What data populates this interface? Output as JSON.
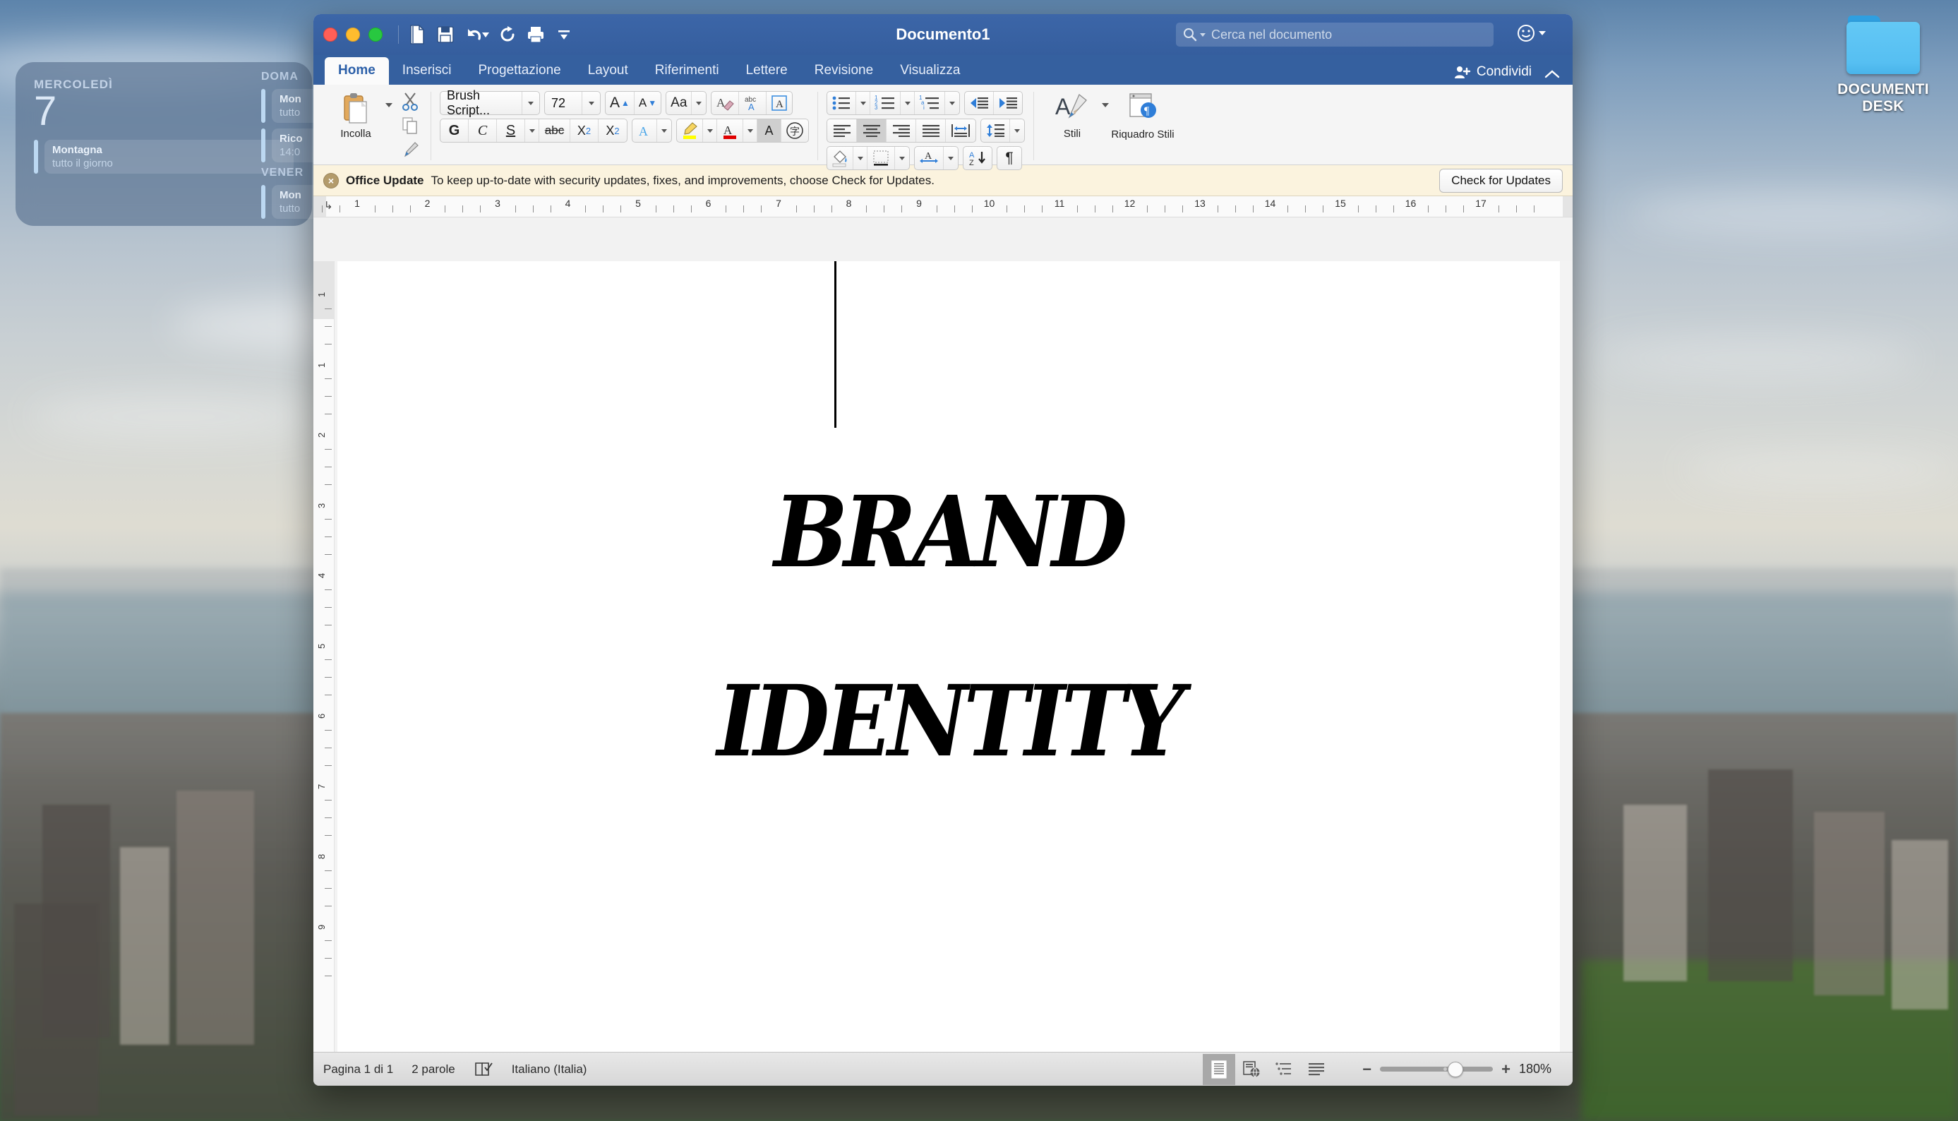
{
  "desktop": {
    "icon": {
      "name": "DOCUMENTI DESK",
      "kind": "folder"
    },
    "wallpaper_description": "Aerial view of New York City skyline at dusk"
  },
  "calendar_widget": {
    "days": [
      {
        "label": "MERCOLEDÌ",
        "number": "7",
        "events": [
          {
            "title": "Montagna",
            "time": "tutto il giorno"
          }
        ]
      },
      {
        "label": "DOMA",
        "events": [
          {
            "title": "Mon",
            "time": "tutto"
          },
          {
            "title": "Rico",
            "time": "14:0"
          }
        ]
      },
      {
        "label": "VENER",
        "events": [
          {
            "title": "Mon",
            "time": "tutto"
          }
        ]
      }
    ]
  },
  "window": {
    "title": "Documento1",
    "traffic_lights": [
      "close-red",
      "minimize-yellow",
      "maximize-green"
    ],
    "quick_access": [
      {
        "name": "new-document-icon",
        "label": "Nuovo"
      },
      {
        "name": "save-icon",
        "label": "Salva"
      },
      {
        "name": "undo-icon",
        "label": "Annulla"
      },
      {
        "name": "redo-icon",
        "label": "Ripeti"
      },
      {
        "name": "print-icon",
        "label": "Stampa"
      },
      {
        "name": "customize-toolbar-icon",
        "label": "Personalizza"
      }
    ],
    "search": {
      "placeholder": "Cerca nel documento",
      "value": ""
    },
    "smiley_label": "Feedback"
  },
  "ribbon": {
    "tabs": [
      {
        "label": "Home",
        "active": true
      },
      {
        "label": "Inserisci",
        "active": false
      },
      {
        "label": "Progettazione",
        "active": false
      },
      {
        "label": "Layout",
        "active": false
      },
      {
        "label": "Riferimenti",
        "active": false
      },
      {
        "label": "Lettere",
        "active": false
      },
      {
        "label": "Revisione",
        "active": false
      },
      {
        "label": "Visualizza",
        "active": false
      }
    ],
    "share_label": "Condividi",
    "collapse_label": "^",
    "clipboard": {
      "paste_label": "Incolla",
      "cut_label": "Taglia",
      "copy_label": "Copia",
      "format_painter_label": "Copia formato"
    },
    "font": {
      "family_value": "Brush Script...",
      "size_value": "72",
      "grow_label": "A",
      "shrink_label": "A",
      "change_case_label": "Aa",
      "clear_formatting_label": "A",
      "spelling_label": "abc",
      "text_effects_label": "A",
      "bold_label": "G",
      "italic_label": "C",
      "underline_label": "S",
      "strikethrough_label": "abc",
      "subscript_label": "X₂",
      "superscript_label": "X²",
      "text_highlight_label": "A",
      "font_color_label": "A",
      "shading_label": "A",
      "phonetic_label": "字"
    },
    "paragraph": {
      "bullets_label": "Elenco puntato",
      "numbering_label": "Elenco numerato",
      "multilevel_label": "Elenco multilivello",
      "decrease_indent_label": "Riduci rientro",
      "increase_indent_label": "Aumenta rientro",
      "align_left_label": "Allinea a sinistra",
      "align_center_label": "Centra",
      "align_right_label": "Allinea a destra",
      "justify_label": "Giustifica",
      "distribute_label": "Distribuisci",
      "line_spacing_label": "Interlinea",
      "shading_label": "Sfondo",
      "borders_label": "Bordi",
      "text_direction_label": "Direzione testo",
      "sort_label": "Ordina",
      "show_marks_label": "¶",
      "active_alignment": "center"
    },
    "styles": {
      "styles_label": "Stili",
      "styles_pane_label": "Riquadro Stili"
    }
  },
  "banner": {
    "title": "Office Update",
    "message": "To keep up-to-date with security updates, fixes, and improvements, choose Check for Updates.",
    "button_label": "Check for Updates",
    "close_label": "×"
  },
  "rulers": {
    "horizontal_ticks": [
      "1",
      "2",
      "3",
      "4",
      "5",
      "6",
      "7",
      "8",
      "9",
      "10",
      "11",
      "12",
      "13",
      "14",
      "15",
      "16",
      "17"
    ],
    "vertical_ticks": [
      "1",
      "1",
      "2",
      "3",
      "4",
      "5",
      "6",
      "7",
      "8",
      "9"
    ],
    "units": "cm"
  },
  "document": {
    "lines": [
      {
        "text": "BRAND"
      },
      {
        "text": "IDENTITY"
      }
    ],
    "caret_visible": true
  },
  "status_bar": {
    "page_info": "Pagina 1 di 1",
    "word_count": "2 parole",
    "proofing_icon_label": "Controllo ortografia",
    "language": "Italiano (Italia)",
    "view_modes": [
      {
        "name": "print-layout-view",
        "active": true
      },
      {
        "name": "web-layout-view",
        "active": false
      },
      {
        "name": "outline-view",
        "active": false
      },
      {
        "name": "draft-view",
        "active": false
      }
    ],
    "zoom_out_label": "−",
    "zoom_in_label": "+",
    "zoom_value": "180%",
    "zoom_position_pct": 60
  },
  "colors": {
    "titlebar": "#35609f",
    "tab_active_bg": "#fbfbfb",
    "tab_active_text": "#2b5fa8",
    "ribbon_bg": "#f5f5f5",
    "banner_bg": "#fbf3de",
    "accent_blue": "#2f7ed8",
    "highlight_yellow": "#ffff00",
    "font_color_red": "#e00000",
    "statusbar_bg": "#dedede",
    "folder_blue": "#56bff2"
  }
}
